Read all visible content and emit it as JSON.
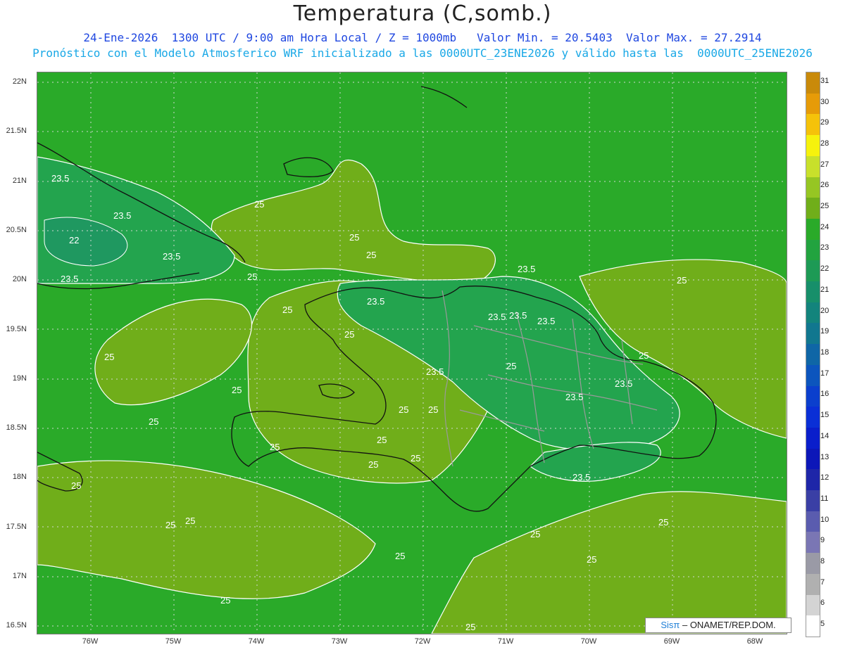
{
  "header": {
    "title": "Temperatura (C,somb.)",
    "subtitle_line1": "24-Ene-2026  1300 UTC / 9:00 am Hora Local / Z = 1000mb   Valor Min. = 20.5403  Valor Max. = 27.2914",
    "subtitle_line2": "Pronóstico con el Modelo Atmosferico WRF inicializado a las 0000UTC_23ENE2026 y válido hasta las  0000UTC_25ENE2026"
  },
  "map": {
    "lat_ticks": [
      "22N",
      "21.5N",
      "21N",
      "20.5N",
      "20N",
      "19.5N",
      "19N",
      "18.5N",
      "18N",
      "17.5N",
      "17N",
      "16.5N"
    ],
    "lon_ticks": [
      "76W",
      "75W",
      "74W",
      "73W",
      "72W",
      "71W",
      "70W",
      "69W",
      "68W"
    ],
    "contour_labels": [
      "23.5",
      "25",
      "22"
    ],
    "colors": {
      "field_24": "#2aaa29",
      "field_25": "#70ae1a",
      "field_23": "#23a44e",
      "field_22": "#1f9860",
      "coastline": "#111111",
      "borders": "#9a9a9a",
      "contour": "#ffffff"
    }
  },
  "colorbar": {
    "labels": [
      "31",
      "30",
      "29",
      "28",
      "27",
      "26",
      "25",
      "24",
      "23",
      "22",
      "21",
      "20",
      "19",
      "18",
      "17",
      "16",
      "15",
      "14",
      "13",
      "12",
      "11",
      "10",
      "9",
      "8",
      "7",
      "6",
      "5"
    ],
    "colors": [
      "#c98a0a",
      "#e69b08",
      "#f5c20a",
      "#f6f20d",
      "#c8e02b",
      "#96c623",
      "#70ae1a",
      "#2aaa29",
      "#22a33f",
      "#1d9a55",
      "#178f6a",
      "#13847c",
      "#11778f",
      "#0f66a6",
      "#0c55bd",
      "#0b3fcd",
      "#0a2fd6",
      "#0a1ecb",
      "#0c17b8",
      "#1e26a8",
      "#3a3fa5",
      "#5a5caf",
      "#7a76b4",
      "#9a9aa6",
      "#b0b0b0",
      "#d4d4d4",
      "#ffffff"
    ]
  },
  "credit": {
    "sis": "Sisπ",
    "rest": " – ONAMET/REP.DOM."
  }
}
